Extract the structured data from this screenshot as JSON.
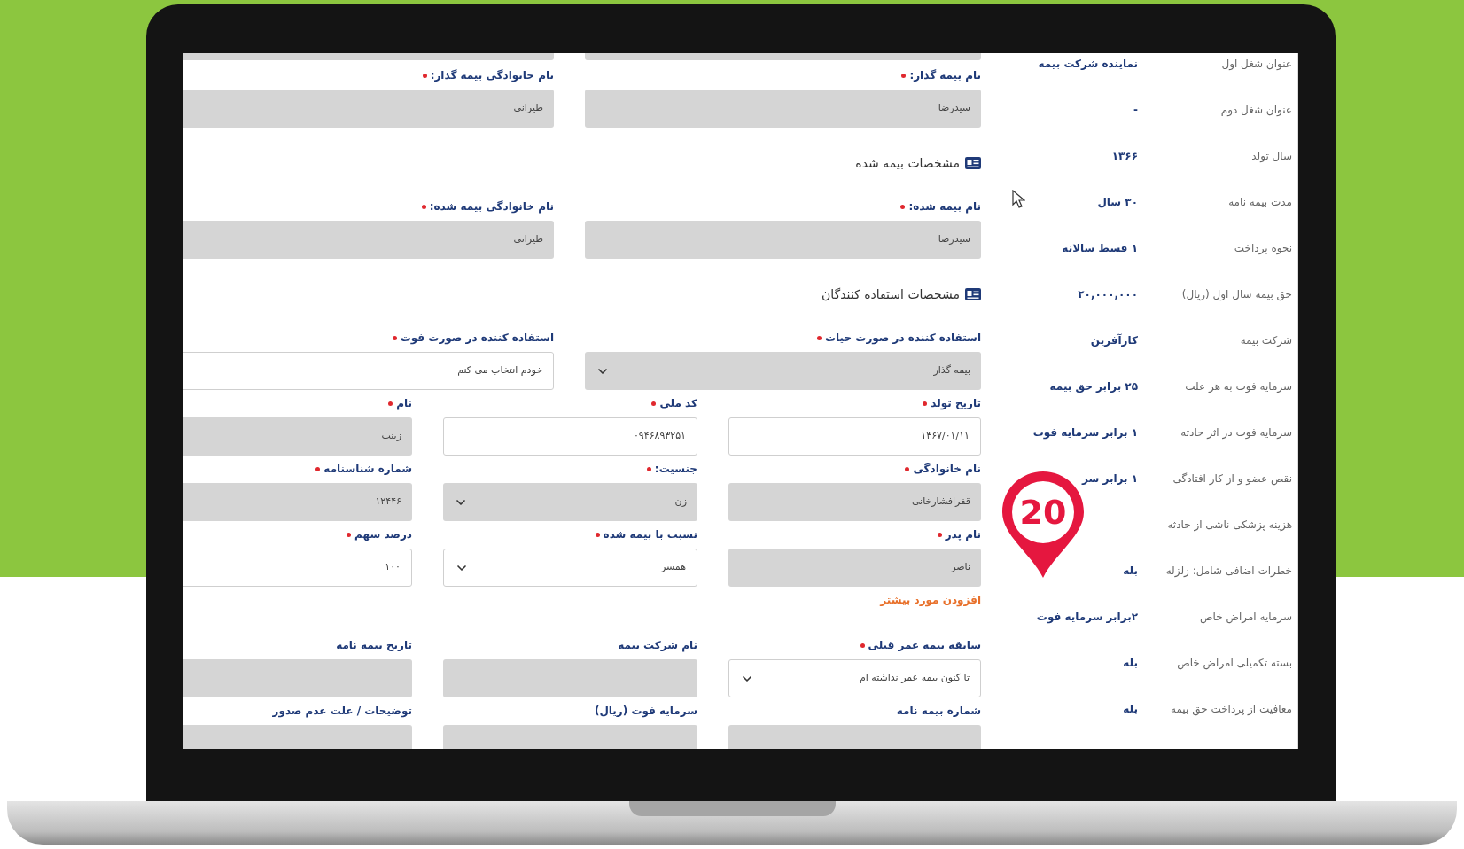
{
  "form": {
    "blocks": [
      {
        "kind": "pair",
        "fields": [
          {
            "label": "نام بیمه گذار:",
            "required": true,
            "value": "سیدرضا",
            "disabled": true,
            "kind": "text"
          },
          {
            "label": "نام خانوادگی بیمه گذار:",
            "required": true,
            "value": "طیرانی",
            "disabled": true,
            "kind": "text"
          }
        ]
      },
      {
        "kind": "heading",
        "text": "مشخصات بیمه شده"
      },
      {
        "kind": "pair",
        "fields": [
          {
            "label": "نام بیمه شده:",
            "required": true,
            "value": "سیدرضا",
            "disabled": true,
            "kind": "text"
          },
          {
            "label": "نام خانوادگی بیمه شده:",
            "required": true,
            "value": "طیرانی",
            "disabled": true,
            "kind": "text"
          }
        ]
      },
      {
        "kind": "heading",
        "text": "مشخصات استفاده کنندگان"
      },
      {
        "kind": "pair",
        "fields": [
          {
            "label": "استفاده کننده در صورت حیات",
            "required": true,
            "value": "بیمه گذار",
            "disabled": true,
            "kind": "select"
          },
          {
            "label": "استفاده کننده در صورت فوت",
            "required": true,
            "value": "خودم انتخاب می کنم",
            "disabled": false,
            "kind": "text"
          }
        ]
      },
      {
        "kind": "trio",
        "fields": [
          {
            "label": "تاریخ تولد",
            "required": true,
            "value": "۱۳۶۷/۰۱/۱۱",
            "disabled": false,
            "kind": "text"
          },
          {
            "label": "کد ملی",
            "required": true,
            "value": "۰۹۴۶۸۹۳۲۵۱",
            "disabled": false,
            "kind": "text"
          },
          {
            "label": "نام",
            "required": true,
            "value": "زینب",
            "disabled": true,
            "kind": "text"
          }
        ]
      },
      {
        "kind": "trio",
        "fields": [
          {
            "label": "نام خانوادگی",
            "required": true,
            "value": "قفرافشارخانی",
            "disabled": true,
            "kind": "text"
          },
          {
            "label": "جنسیت:",
            "required": true,
            "value": "زن",
            "disabled": true,
            "kind": "select"
          },
          {
            "label": "شماره شناسنامه",
            "required": true,
            "value": "۱۲۴۴۶",
            "disabled": true,
            "kind": "text"
          }
        ]
      },
      {
        "kind": "trio",
        "fields": [
          {
            "label": "نام پدر",
            "required": true,
            "value": "ناصر",
            "disabled": true,
            "kind": "text"
          },
          {
            "label": "نسبت با بیمه شده",
            "required": true,
            "value": "همسر",
            "disabled": false,
            "kind": "select"
          },
          {
            "label": "درصد سهم",
            "required": true,
            "value": "۱۰۰",
            "disabled": false,
            "kind": "text"
          }
        ]
      },
      {
        "kind": "link",
        "text": "افزودن مورد بیشتر"
      },
      {
        "kind": "trio",
        "fields": [
          {
            "label": "سابقه بیمه عمر قبلی",
            "required": true,
            "value": "تا کنون بیمه عمر نداشته ام",
            "disabled": false,
            "kind": "select"
          },
          {
            "label": "نام شرکت بیمه",
            "required": false,
            "disabled": true,
            "kind": "text"
          },
          {
            "label": "تاریخ بیمه نامه",
            "required": false,
            "disabled": true,
            "kind": "text"
          }
        ]
      },
      {
        "kind": "trio",
        "fields": [
          {
            "label": "شماره بیمه نامه",
            "required": false,
            "disabled": true,
            "kind": "text"
          },
          {
            "label": "سرمایه فوت (ریال)",
            "required": false,
            "disabled": true,
            "kind": "text"
          },
          {
            "label": "توضیحات / علت عدم صدور",
            "required": false,
            "disabled": true,
            "kind": "text"
          }
        ]
      }
    ]
  },
  "summary": [
    {
      "label": "عنوان شغل اول",
      "value": "نماینده شرکت بیمه"
    },
    {
      "label": "عنوان شغل دوم",
      "value": "-"
    },
    {
      "label": "سال تولد",
      "value": "۱۳۶۶"
    },
    {
      "label": "مدت بیمه نامه",
      "value": "۳۰ سال"
    },
    {
      "label": "نحوه پرداخت",
      "value": "۱ قسط سالانه"
    },
    {
      "label": "حق بیمه سال اول (ریال)",
      "value": "۲۰,۰۰۰,۰۰۰"
    },
    {
      "label": "شرکت بیمه",
      "value": "کارآفرین"
    },
    {
      "label": "سرمایه فوت به هر علت",
      "value": "۲۵ برابر حق بیمه"
    },
    {
      "label": "سرمایه فوت در اثر حادثه",
      "value": "۱ برابر سرمایه فوت"
    },
    {
      "label": "نقص عضو و از کار افتادگی",
      "value": "۱ برابر سر"
    },
    {
      "label": "هزینه پزشکی ناشی از حادثه"
    },
    {
      "label": "خطرات اضافی شامل: زلزله",
      "value": "بله"
    },
    {
      "label": "سرمایه امراض خاص",
      "value": "۲برابر سرمایه فوت"
    },
    {
      "label": "بسته تکمیلی امراض خاص",
      "value": "بله"
    },
    {
      "label": "معافیت از پرداخت حق بیمه",
      "value": "بله"
    }
  ],
  "badge": {
    "text": "20"
  }
}
